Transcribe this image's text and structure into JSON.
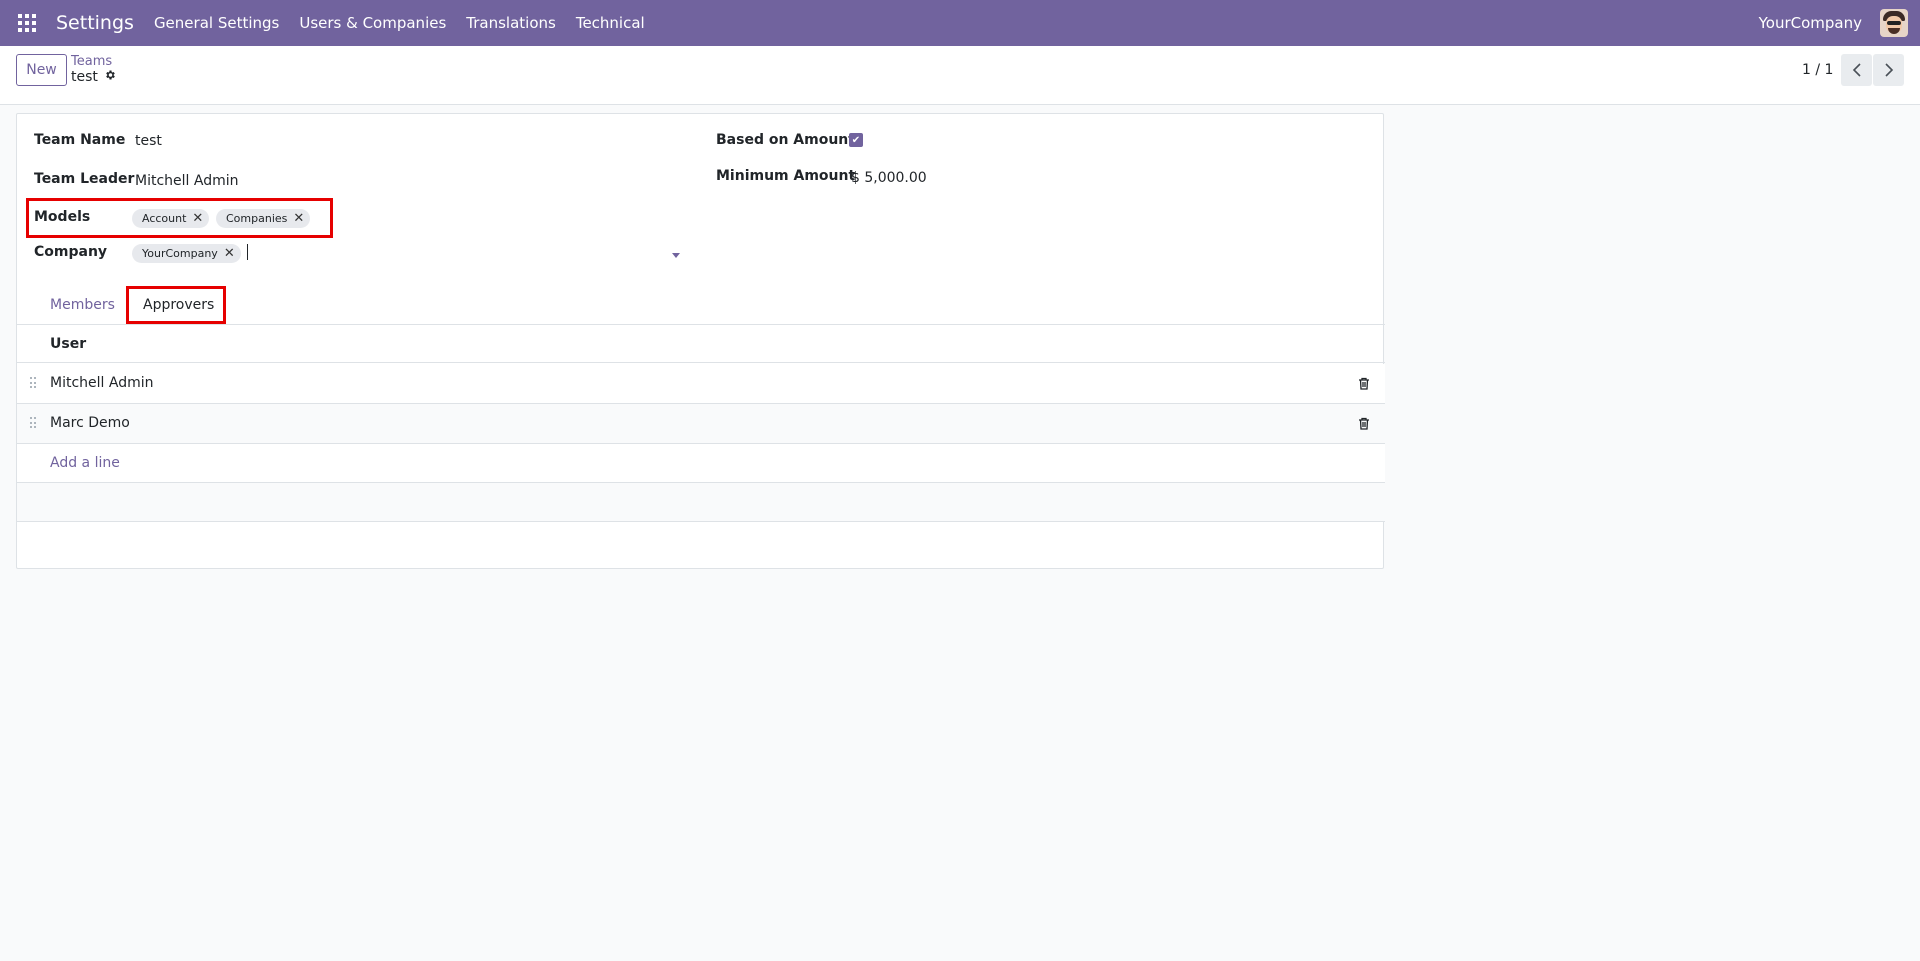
{
  "navbar": {
    "app_title": "Settings",
    "menu": [
      "General Settings",
      "Users & Companies",
      "Translations",
      "Technical"
    ],
    "company": "YourCompany"
  },
  "control_panel": {
    "new_label": "New",
    "breadcrumb": "Teams",
    "record_name": "test",
    "pager": "1 / 1"
  },
  "form": {
    "team_name_label": "Team Name",
    "team_name": "test",
    "team_leader_label": "Team Leader",
    "team_leader": "Mitchell Admin",
    "models_label": "Models",
    "models": [
      "Account",
      "Companies"
    ],
    "company_label": "Company",
    "companies": [
      "YourCompany"
    ],
    "based_on_amount_label": "Based on Amount",
    "based_on_amount": true,
    "minimum_amount_label": "Minimum Amount",
    "minimum_amount": "$ 5,000.00"
  },
  "tabs": {
    "members": "Members",
    "approvers": "Approvers",
    "active": "approvers"
  },
  "list": {
    "column_user": "User",
    "rows": [
      "Mitchell Admin",
      "Marc Demo"
    ],
    "add_line": "Add a line"
  },
  "colors": {
    "brand": "#71639e",
    "highlight": "#e60000"
  }
}
